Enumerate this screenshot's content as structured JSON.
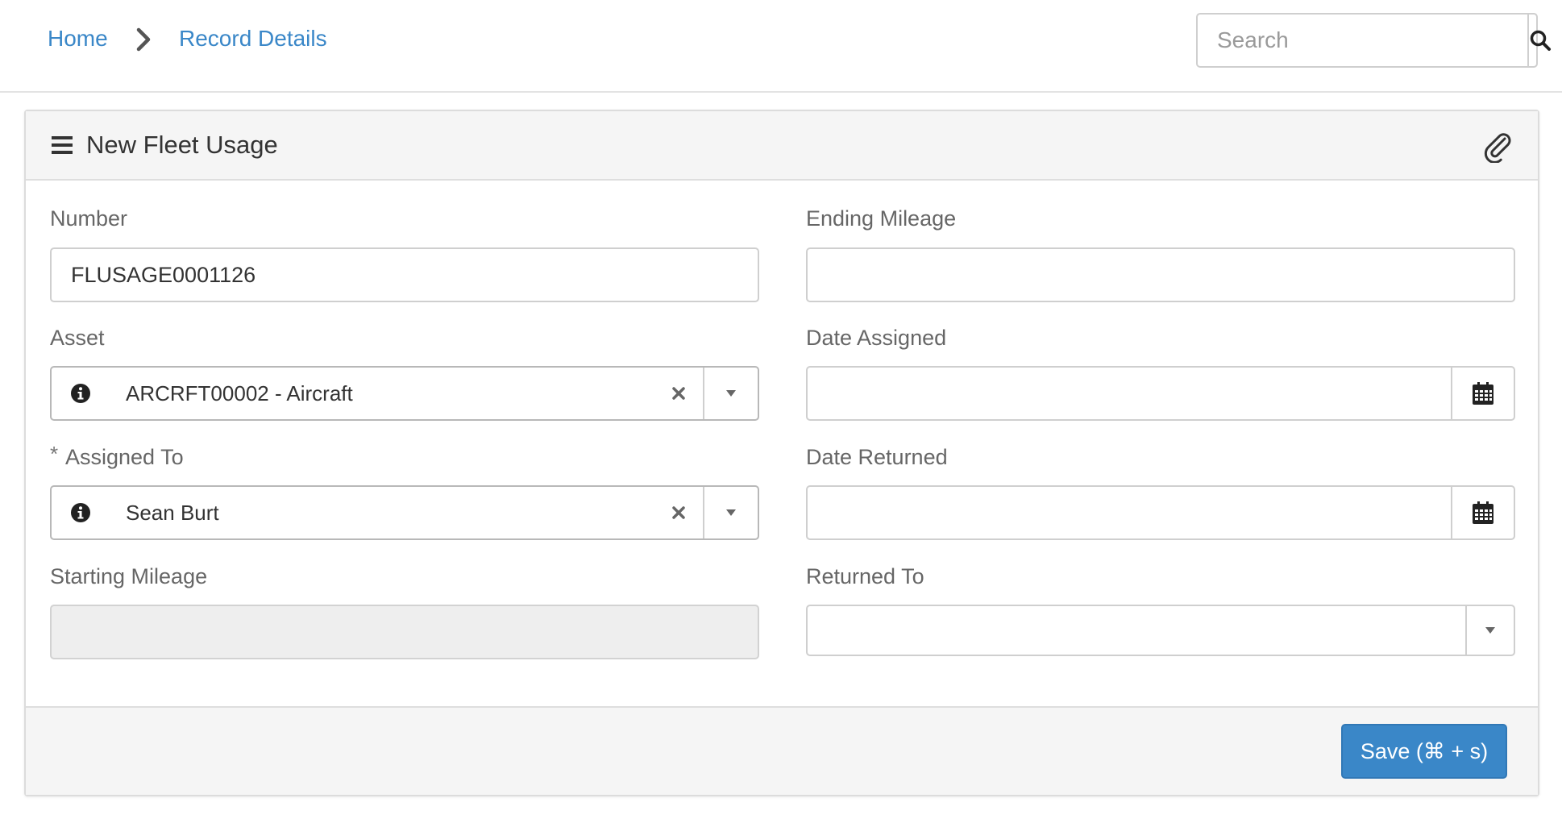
{
  "breadcrumb": {
    "home": "Home",
    "current": "Record Details"
  },
  "search": {
    "placeholder": "Search",
    "value": ""
  },
  "panel": {
    "title": "New Fleet Usage"
  },
  "fields": {
    "number": {
      "label": "Number",
      "value": "FLUSAGE0001126"
    },
    "asset": {
      "label": "Asset",
      "value": "ARCRFT00002 - Aircraft"
    },
    "assigned_to": {
      "label": "Assigned To",
      "required_marker": "*",
      "value": "Sean Burt"
    },
    "starting_mileage": {
      "label": "Starting Mileage",
      "value": ""
    },
    "ending_mileage": {
      "label": "Ending Mileage",
      "value": ""
    },
    "date_assigned": {
      "label": "Date Assigned",
      "value": ""
    },
    "date_returned": {
      "label": "Date Returned",
      "value": ""
    },
    "returned_to": {
      "label": "Returned To",
      "value": ""
    }
  },
  "footer": {
    "save_label": "Save (⌘ + s)"
  },
  "colors": {
    "accent": "#3a87c8",
    "header_bg": "#f5f5f5",
    "disabled_bg": "#eeeeee"
  }
}
